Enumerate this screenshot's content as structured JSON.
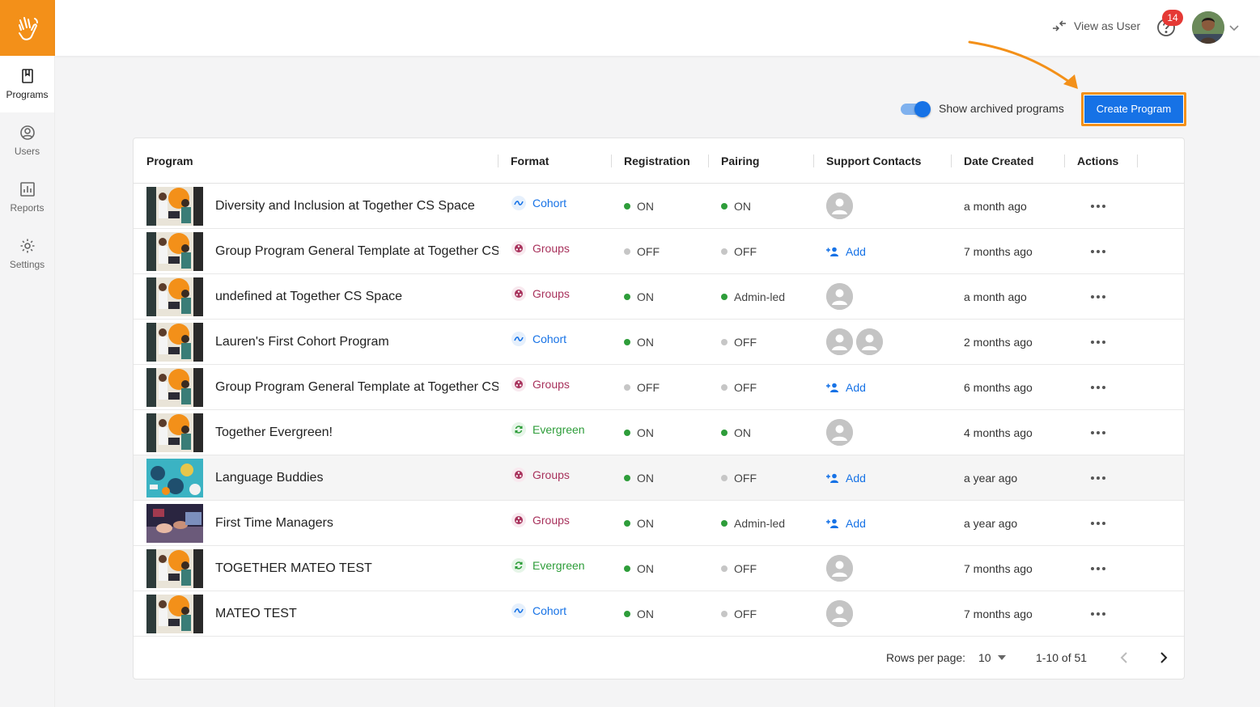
{
  "colors": {
    "brand": "#f39019",
    "primary": "#1672e6",
    "on": "#2e9d3a",
    "off": "#c6c6c6",
    "groups": "#a8325c",
    "cohort": "#1672e6",
    "evergreen": "#2e9d3a"
  },
  "sidebar": {
    "logo_icon": "hand-wave-icon",
    "items": [
      {
        "label": "Programs",
        "icon": "book-icon"
      },
      {
        "label": "Users",
        "icon": "user-circle-icon"
      },
      {
        "label": "Reports",
        "icon": "bar-chart-icon"
      },
      {
        "label": "Settings",
        "icon": "gear-icon"
      }
    ]
  },
  "header": {
    "view_as_user": "View as User",
    "notification_count": "14"
  },
  "toolbar": {
    "show_archived_label": "Show archived programs",
    "show_archived_on": true,
    "create_button": "Create Program"
  },
  "table": {
    "columns": [
      "Program",
      "Format",
      "Registration",
      "Pairing",
      "Support Contacts",
      "Date Created",
      "Actions"
    ],
    "rows": [
      {
        "program": "Diversity and Inclusion at Together CS Space",
        "format": "Cohort",
        "registration": "ON",
        "pairing": "ON",
        "contacts": 1,
        "date": "a month ago"
      },
      {
        "program": "Group Program General Template at Together CS Space",
        "format": "Groups",
        "registration": "OFF",
        "pairing": "OFF",
        "contacts": 0,
        "add_label": "Add",
        "date": "7 months ago"
      },
      {
        "program": "undefined at Together CS Space",
        "format": "Groups",
        "registration": "ON",
        "pairing": "Admin-led",
        "contacts": 1,
        "date": "a month ago"
      },
      {
        "program": "Lauren's First Cohort Program",
        "format": "Cohort",
        "registration": "ON",
        "pairing": "OFF",
        "contacts": 2,
        "date": "2 months ago"
      },
      {
        "program": "Group Program General Template at Together CS Space",
        "format": "Groups",
        "registration": "OFF",
        "pairing": "OFF",
        "contacts": 0,
        "add_label": "Add",
        "date": "6 months ago"
      },
      {
        "program": "Together Evergreen!",
        "format": "Evergreen",
        "registration": "ON",
        "pairing": "ON",
        "contacts": 1,
        "date": "4 months ago"
      },
      {
        "program": "Language Buddies",
        "format": "Groups",
        "registration": "ON",
        "pairing": "OFF",
        "contacts": 0,
        "add_label": "Add",
        "date": "a year ago"
      },
      {
        "program": "First Time Managers",
        "format": "Groups",
        "registration": "ON",
        "pairing": "Admin-led",
        "contacts": 0,
        "add_label": "Add",
        "date": "a year ago"
      },
      {
        "program": "TOGETHER MATEO TEST",
        "format": "Evergreen",
        "registration": "ON",
        "pairing": "OFF",
        "contacts": 1,
        "date": "7 months ago"
      },
      {
        "program": "MATEO TEST",
        "format": "Cohort",
        "registration": "ON",
        "pairing": "OFF",
        "contacts": 1,
        "date": "7 months ago"
      }
    ]
  },
  "pagination": {
    "rows_per_page_label": "Rows per page:",
    "rows_per_page": "10",
    "range": "1-10 of 51"
  }
}
